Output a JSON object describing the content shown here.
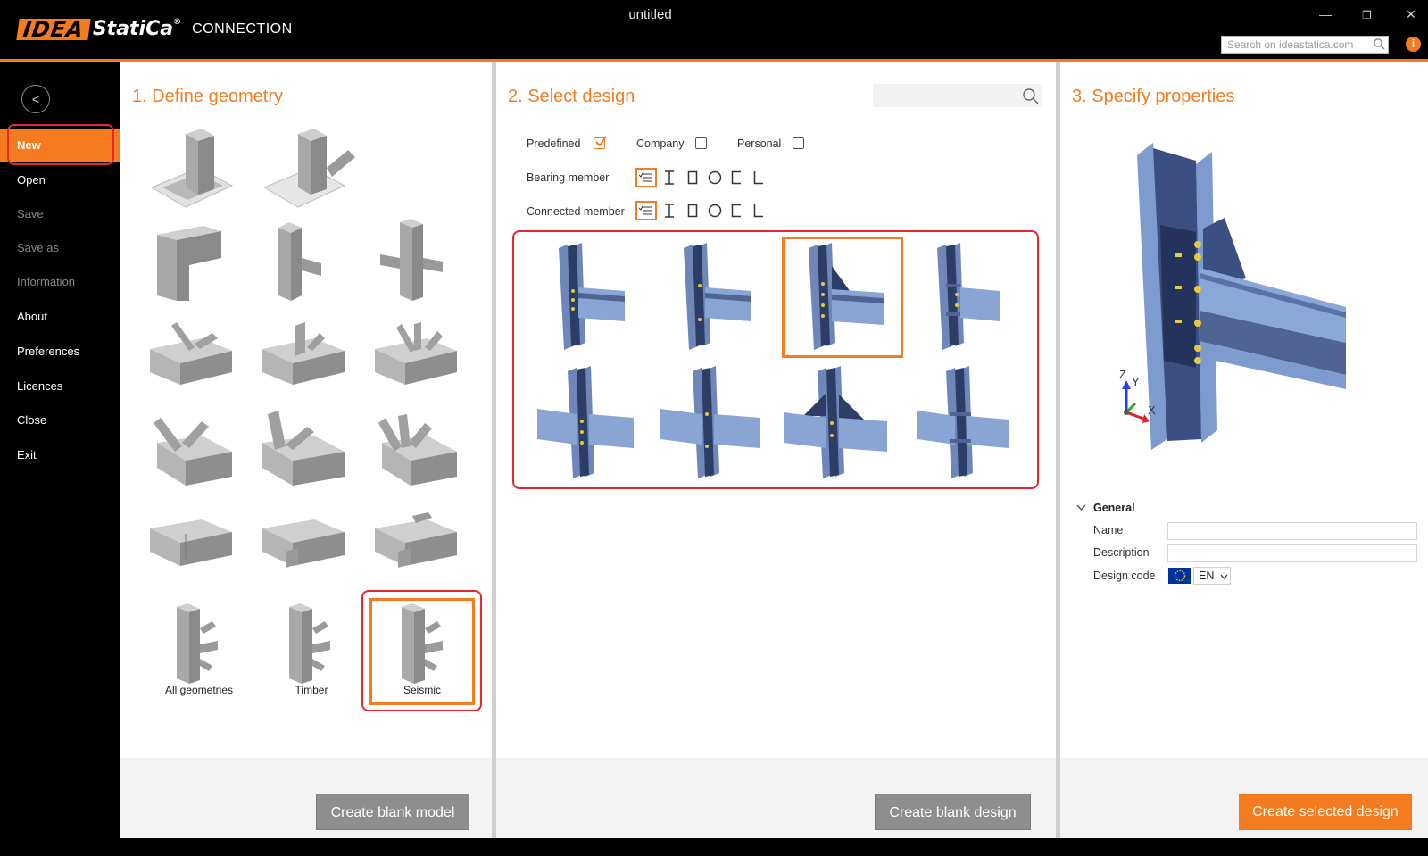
{
  "app": {
    "logo_idea": "IDEA",
    "logo_statica": "StatiCa",
    "logo_reg": "®",
    "product": "CONNECTION",
    "window_title": "untitled",
    "search_placeholder": "Search on ideastatica.com",
    "info_glyph": "i",
    "accent_color": "#f47b20"
  },
  "sidebar": {
    "back_glyph": "<",
    "items": [
      {
        "label": "New",
        "state": "active"
      },
      {
        "label": "Open",
        "state": "normal"
      },
      {
        "label": "Save",
        "state": "disabled"
      },
      {
        "label": "Save as",
        "state": "disabled"
      },
      {
        "label": "Information",
        "state": "disabled"
      },
      {
        "label": "About",
        "state": "normal"
      },
      {
        "label": "Preferences",
        "state": "normal"
      },
      {
        "label": "Licences",
        "state": "normal"
      },
      {
        "label": "Close",
        "state": "normal"
      },
      {
        "label": "Exit",
        "state": "normal"
      }
    ]
  },
  "geometry": {
    "title": "1. Define geometry",
    "labels": [
      "All geometries",
      "Timber",
      "Seismic"
    ],
    "selected": "Seismic",
    "create_button": "Create blank model"
  },
  "design": {
    "title": "2. Select design",
    "options": [
      {
        "label": "Predefined",
        "checked": true
      },
      {
        "label": "Company",
        "checked": false
      },
      {
        "label": "Personal",
        "checked": false
      }
    ],
    "bearing_label": "Bearing member",
    "connected_label": "Connected member",
    "member_icons": [
      "list-filter-icon",
      "i-section-icon",
      "rectangular-hollow-icon",
      "circular-hollow-icon",
      "channel-section-icon",
      "angle-section-icon"
    ],
    "selected_index": 2,
    "create_button": "Create blank design"
  },
  "properties": {
    "title": "3. Specify properties",
    "section": "General",
    "name_label": "Name",
    "description_label": "Description",
    "code_label": "Design code",
    "code_value": "EN",
    "axis_z": "Z",
    "axis_y": "Y",
    "axis_x": "X",
    "create_button": "Create selected design"
  }
}
